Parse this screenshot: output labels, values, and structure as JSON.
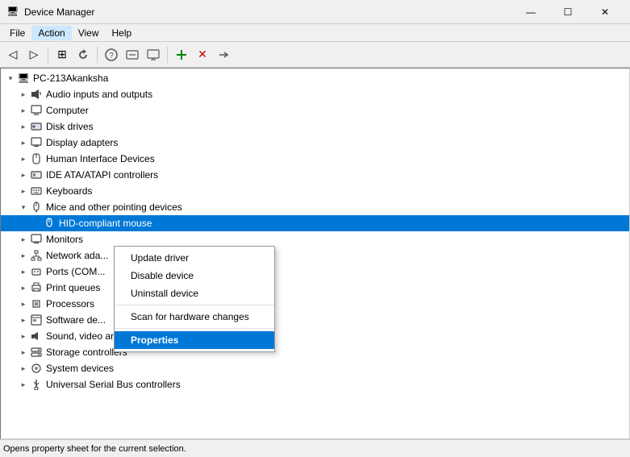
{
  "titleBar": {
    "icon": "🖥",
    "title": "Device Manager",
    "minBtn": "—",
    "maxBtn": "☐",
    "closeBtn": "✕"
  },
  "menuBar": {
    "items": [
      "File",
      "Action",
      "View",
      "Help"
    ]
  },
  "toolbar": {
    "buttons": [
      {
        "icon": "◁",
        "name": "back"
      },
      {
        "icon": "▷",
        "name": "forward"
      },
      {
        "icon": "⊞",
        "name": "properties"
      },
      {
        "icon": "↺",
        "name": "refresh"
      },
      {
        "icon": "?",
        "name": "help"
      },
      {
        "icon": "⊟",
        "name": "remove"
      },
      {
        "icon": "☰",
        "name": "list"
      },
      {
        "icon": "🖥",
        "name": "computer"
      },
      {
        "icon": "✕",
        "name": "uninstall"
      },
      {
        "icon": "⬇",
        "name": "update"
      }
    ]
  },
  "tree": {
    "root": {
      "label": "PC-213Akanksha",
      "expanded": true
    },
    "items": [
      {
        "label": "Audio inputs and outputs",
        "indent": 2,
        "icon": "🔊"
      },
      {
        "label": "Computer",
        "indent": 2,
        "icon": "🖥"
      },
      {
        "label": "Disk drives",
        "indent": 2,
        "icon": "💾"
      },
      {
        "label": "Display adapters",
        "indent": 2,
        "icon": "🖵"
      },
      {
        "label": "Human Interface Devices",
        "indent": 2,
        "icon": "🕹"
      },
      {
        "label": "IDE ATA/ATAPI controllers",
        "indent": 2,
        "icon": "📋"
      },
      {
        "label": "Keyboards",
        "indent": 2,
        "icon": "⌨"
      },
      {
        "label": "Mice and other pointing devices",
        "indent": 2,
        "icon": "🖱",
        "expanded": true
      },
      {
        "label": "HID-compliant mouse",
        "indent": 3,
        "icon": "🖱",
        "selected": true
      },
      {
        "label": "Monitors",
        "indent": 2,
        "icon": "🖵"
      },
      {
        "label": "Network ada...",
        "indent": 2,
        "icon": "🌐"
      },
      {
        "label": "Ports (COM...",
        "indent": 2,
        "icon": "🔌"
      },
      {
        "label": "Print queues",
        "indent": 2,
        "icon": "🖨"
      },
      {
        "label": "Processors",
        "indent": 2,
        "icon": "⚙"
      },
      {
        "label": "Software de...",
        "indent": 2,
        "icon": "📦"
      },
      {
        "label": "Sound, video and game controllers",
        "indent": 2,
        "icon": "🎵"
      },
      {
        "label": "Storage controllers",
        "indent": 2,
        "icon": "💿"
      },
      {
        "label": "System devices",
        "indent": 2,
        "icon": "⚙"
      },
      {
        "label": "Universal Serial Bus controllers",
        "indent": 2,
        "icon": "🔌"
      }
    ]
  },
  "contextMenu": {
    "items": [
      {
        "label": "Update driver",
        "type": "item"
      },
      {
        "label": "Disable device",
        "type": "item"
      },
      {
        "label": "Uninstall device",
        "type": "item"
      },
      {
        "type": "sep"
      },
      {
        "label": "Scan for hardware changes",
        "type": "item"
      },
      {
        "type": "sep"
      },
      {
        "label": "Properties",
        "type": "item",
        "highlighted": true
      }
    ]
  },
  "statusBar": {
    "text": "Opens property sheet for the current selection."
  }
}
